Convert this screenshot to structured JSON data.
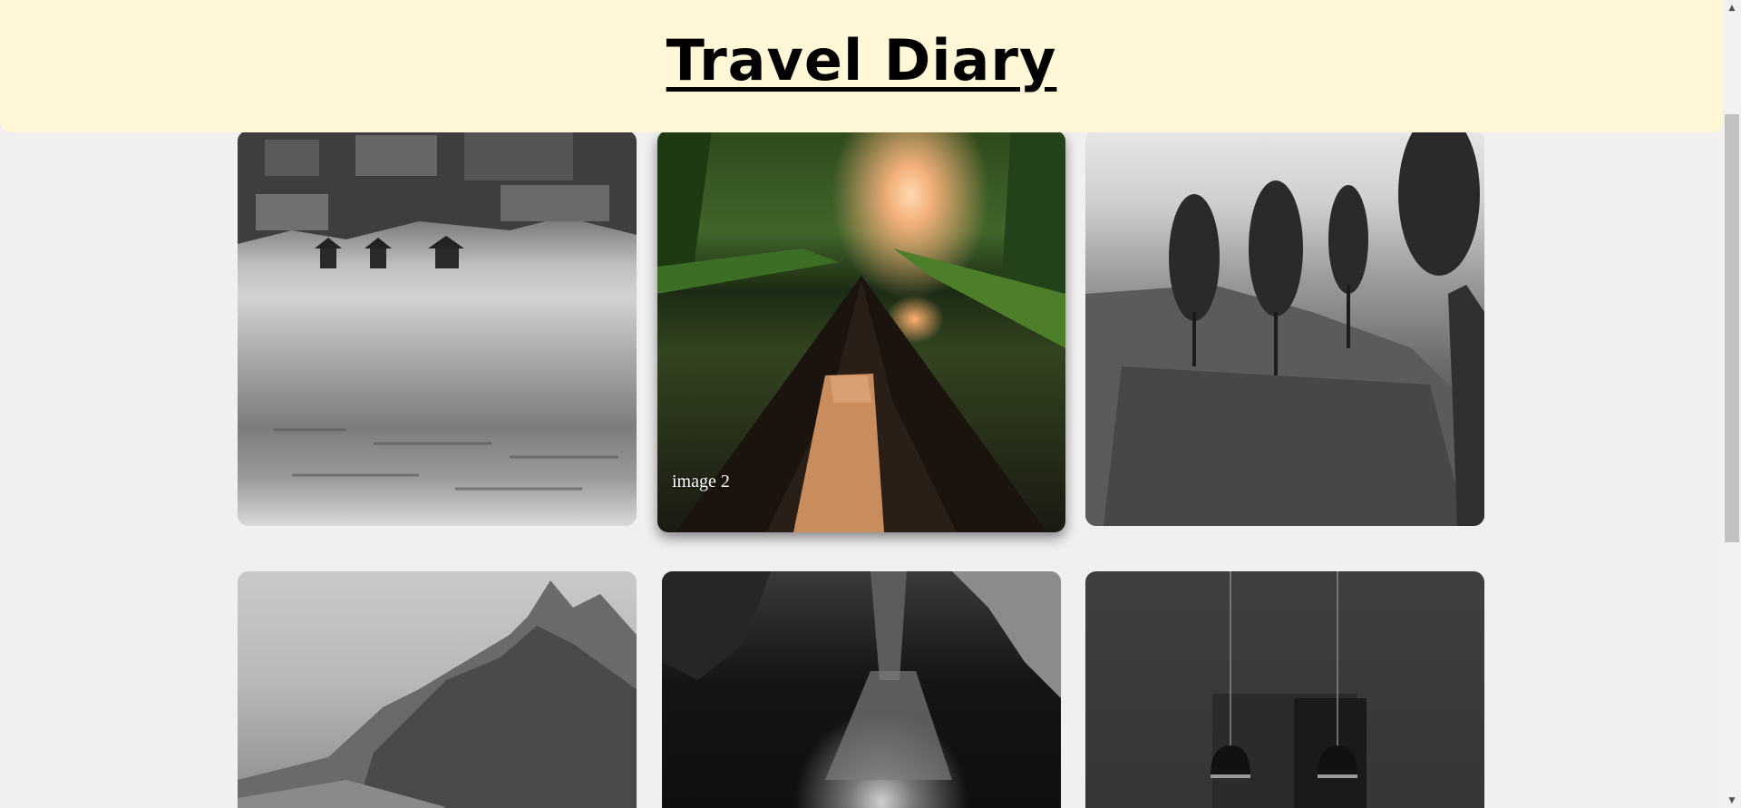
{
  "header": {
    "title": "Travel Diary"
  },
  "gallery": {
    "cards": [
      {
        "name": "lake-village-image",
        "caption": ""
      },
      {
        "name": "canal-boat-image",
        "caption": "image 2"
      },
      {
        "name": "tea-plantation-image",
        "caption": ""
      },
      {
        "name": "mountain-image",
        "caption": ""
      },
      {
        "name": "waterfall-image",
        "caption": ""
      },
      {
        "name": "pendant-lamps-image",
        "caption": ""
      }
    ]
  },
  "scrollbar": {
    "up_icon": "triangle-up-icon",
    "down_icon": "triangle-down-icon"
  }
}
